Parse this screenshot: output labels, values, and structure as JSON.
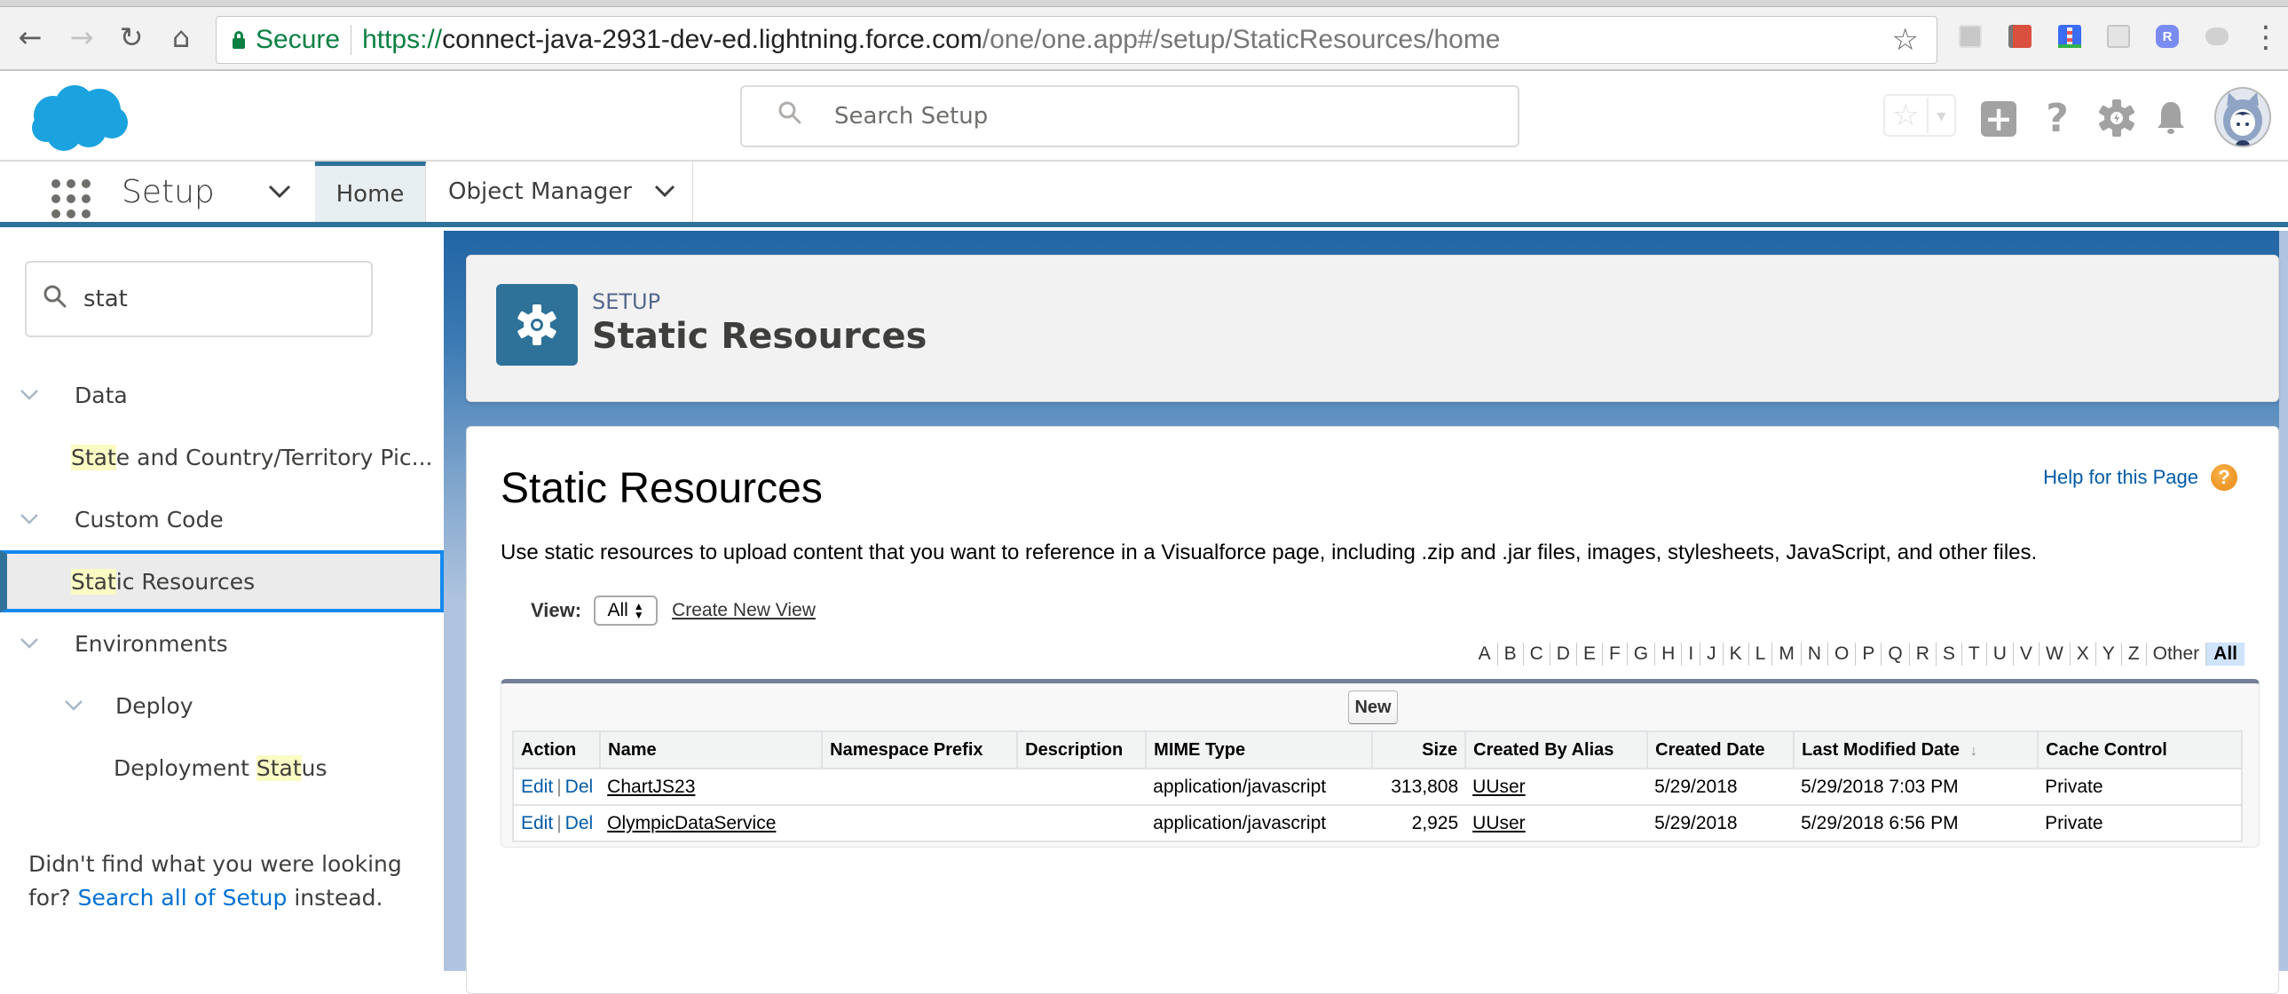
{
  "browser": {
    "nav": {
      "back": "←",
      "forward": "→",
      "reload": "↻",
      "home": "⌂"
    },
    "secure_label": "Secure",
    "url": {
      "scheme": "https://",
      "host": "connect-java-2931-dev-ed.lightning.force.com",
      "path": "/one/one.app#/setup/StaticResources/home"
    },
    "bookmark_icon": "☆",
    "extensions": [
      "tab-manager-icon",
      "dictionary-icon",
      "lighthouse-icon",
      "ghostery-icon",
      "r-extension-icon",
      "salesforce-cloud-icon"
    ],
    "extension_r_label": "R",
    "menu_icon": "⋮"
  },
  "header": {
    "search_placeholder": "Search Setup",
    "icons": {
      "favorites": "☆",
      "favorites_menu": "▾",
      "add": "+",
      "help": "?",
      "setup": "⚙",
      "notifications": "bell",
      "avatar": "avatar"
    }
  },
  "nav": {
    "app_title": "Setup",
    "app_chevron": "⌄",
    "tabs": [
      {
        "label": "Home",
        "active": true
      },
      {
        "label": "Object Manager",
        "active": false,
        "chevron": "⌄"
      }
    ]
  },
  "sidebar": {
    "quick_find_value": "stat",
    "tree": [
      {
        "type": "group",
        "label": "Data",
        "chevron": "⌄"
      },
      {
        "type": "item",
        "highlight": "Stat",
        "rest": "e and Country/Territory Pic...",
        "selected": false
      },
      {
        "type": "group",
        "label": "Custom Code",
        "chevron": "⌄"
      },
      {
        "type": "item",
        "highlight": "Stat",
        "rest": "ic Resources",
        "selected": true
      },
      {
        "type": "group",
        "label": "Environments",
        "chevron": "⌄"
      },
      {
        "type": "subgroup",
        "label": "Deploy",
        "chevron": "⌄"
      },
      {
        "type": "item",
        "prefix": "Deployment ",
        "highlight": "Stat",
        "rest": "us",
        "selected": false
      }
    ],
    "not_found": {
      "text_before": "Didn't find what you were looking for? ",
      "link": "Search all of Setup",
      "text_after": " instead."
    }
  },
  "page_header": {
    "eyebrow": "SETUP",
    "title": "Static Resources",
    "icon": "gear-icon"
  },
  "content": {
    "title": "Static Resources",
    "help_link": "Help for this Page",
    "help_icon": "?",
    "description": "Use static resources to upload content that you want to reference in a Visualforce page, including .zip and .jar files, images, stylesheets, JavaScript, and other files.",
    "view_label": "View:",
    "view_selected": "All",
    "create_new_view": "Create New View",
    "alpha_filter": [
      "A",
      "B",
      "C",
      "D",
      "E",
      "F",
      "G",
      "H",
      "I",
      "J",
      "K",
      "L",
      "M",
      "N",
      "O",
      "P",
      "Q",
      "R",
      "S",
      "T",
      "U",
      "V",
      "W",
      "X",
      "Y",
      "Z",
      "Other",
      "All"
    ],
    "alpha_active": "All",
    "new_button": "New",
    "table": {
      "columns": [
        "Action",
        "Name",
        "Namespace Prefix",
        "Description",
        "MIME Type",
        "Size",
        "Created By Alias",
        "Created Date",
        "Last Modified Date",
        "Cache Control"
      ],
      "sort_column": "Last Modified Date",
      "sort_indicator": "↓",
      "action_edit": "Edit",
      "action_separator": "|",
      "action_del": "Del",
      "rows": [
        {
          "name": "ChartJS23",
          "namespace_prefix": "",
          "description": "",
          "mime_type": "application/javascript",
          "size": "313,808",
          "created_by_alias": "UUser",
          "created_date": "5/29/2018",
          "last_modified_date": "5/29/2018 7:03 PM",
          "cache_control": "Private"
        },
        {
          "name": "OlympicDataService",
          "namespace_prefix": "",
          "description": "",
          "mime_type": "application/javascript",
          "size": "2,925",
          "created_by_alias": "UUser",
          "created_date": "5/29/2018",
          "last_modified_date": "5/29/2018 6:56 PM",
          "cache_control": "Private"
        }
      ]
    }
  },
  "colors": {
    "brand_blue": "#00a1e0",
    "setup_blue": "#2e7299",
    "link_blue": "#0070d2",
    "classic_link": "#015ba7",
    "highlight": "#fbfbc4",
    "selected_border": "#1589ee"
  }
}
